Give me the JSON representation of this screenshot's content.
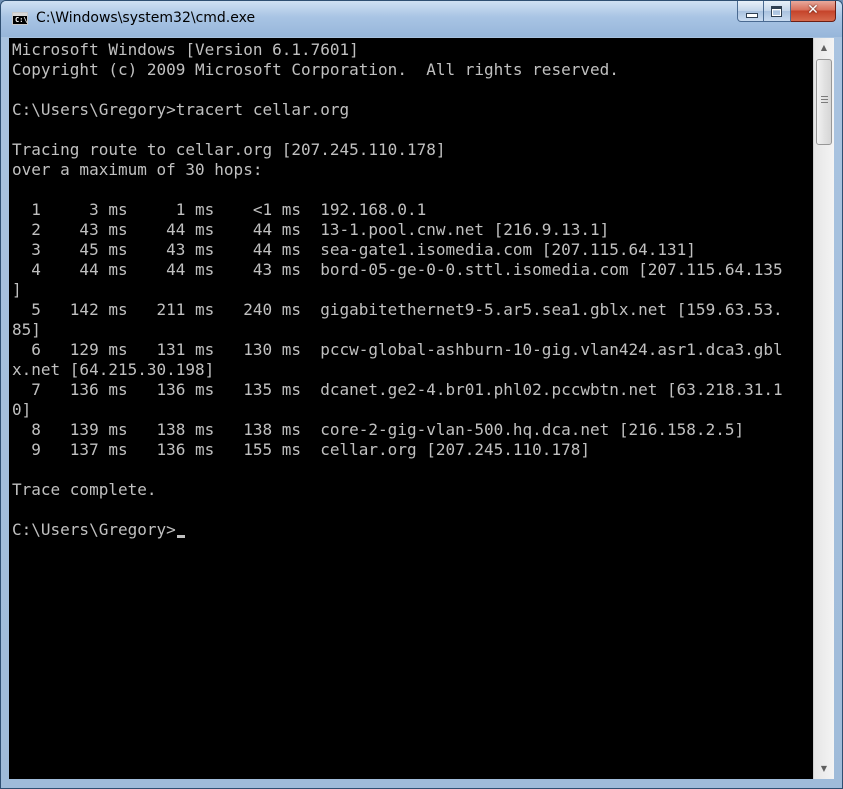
{
  "window": {
    "title": "C:\\Windows\\system32\\cmd.exe",
    "icon_label": "C:\\",
    "close_glyph": "✕"
  },
  "console": {
    "lines": [
      "Microsoft Windows [Version 6.1.7601]",
      "Copyright (c) 2009 Microsoft Corporation.  All rights reserved.",
      "",
      "C:\\Users\\Gregory>tracert cellar.org",
      "",
      "Tracing route to cellar.org [207.245.110.178]",
      "over a maximum of 30 hops:",
      "",
      "  1     3 ms     1 ms    <1 ms  192.168.0.1",
      "  2    43 ms    44 ms    44 ms  13-1.pool.cnw.net [216.9.13.1]",
      "  3    45 ms    43 ms    44 ms  sea-gate1.isomedia.com [207.115.64.131]",
      "  4    44 ms    44 ms    43 ms  bord-05-ge-0-0.sttl.isomedia.com [207.115.64.135",
      "]",
      "  5   142 ms   211 ms   240 ms  gigabitethernet9-5.ar5.sea1.gblx.net [159.63.53.",
      "85]",
      "  6   129 ms   131 ms   130 ms  pccw-global-ashburn-10-gig.vlan424.asr1.dca3.gbl",
      "x.net [64.215.30.198]",
      "  7   136 ms   136 ms   135 ms  dcanet.ge2-4.br01.phl02.pccwbtn.net [63.218.31.1",
      "0]",
      "  8   139 ms   138 ms   138 ms  core-2-gig-vlan-500.hq.dca.net [216.158.2.5]",
      "  9   137 ms   136 ms   155 ms  cellar.org [207.245.110.178]",
      "",
      "Trace complete.",
      "",
      "C:\\Users\\Gregory>"
    ]
  },
  "scrollbar": {
    "up_glyph": "▲",
    "down_glyph": "▼"
  }
}
